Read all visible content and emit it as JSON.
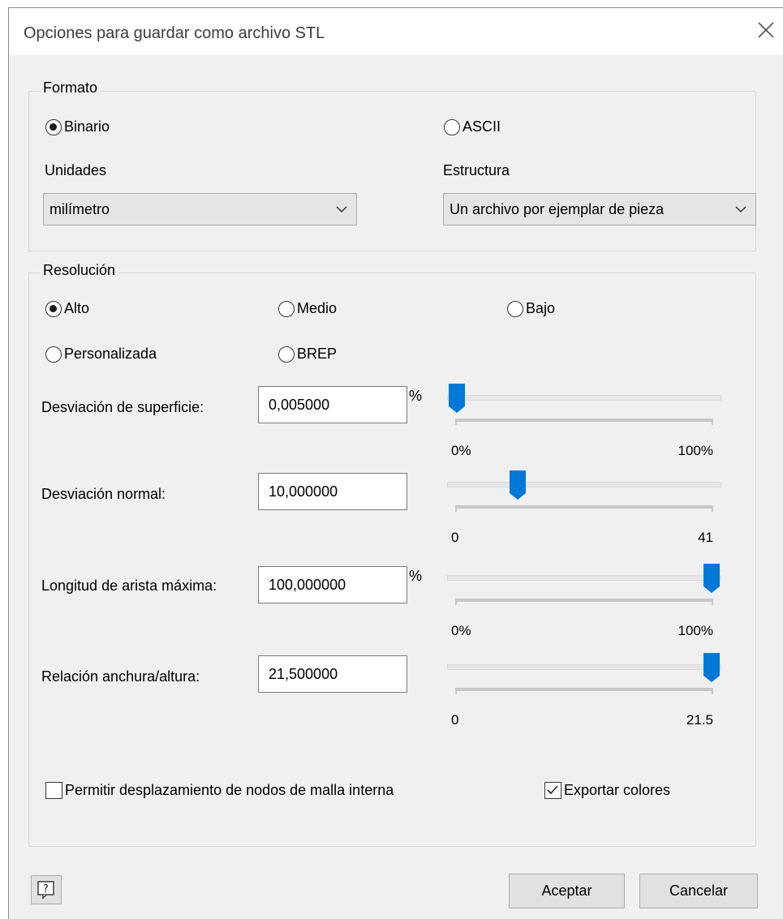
{
  "window": {
    "title": "Opciones para guardar como archivo STL"
  },
  "formato": {
    "legend": "Formato",
    "binario_label": "Binario",
    "ascii_label": "ASCII",
    "selected": "Binario",
    "unidades_label": "Unidades",
    "unidades_value": "milímetro",
    "estructura_label": "Estructura",
    "estructura_value": "Un archivo por ejemplar de pieza"
  },
  "resolucion": {
    "legend": "Resolución",
    "alto_label": "Alto",
    "medio_label": "Medio",
    "bajo_label": "Bajo",
    "personalizada_label": "Personalizada",
    "brep_label": "BREP",
    "selected": "Alto",
    "params": [
      {
        "label": "Desviación de superficie:",
        "value": "0,005000",
        "unit": "%",
        "min_label": "0%",
        "max_label": "100%",
        "slider_fraction": 0.0
      },
      {
        "label": "Desviación normal:",
        "value": "10,000000",
        "unit": "",
        "min_label": "0",
        "max_label": "41",
        "slider_fraction": 0.24
      },
      {
        "label": "Longitud de arista máxima:",
        "value": "100,000000",
        "unit": "%",
        "min_label": "0%",
        "max_label": "100%",
        "slider_fraction": 1.0
      },
      {
        "label": "Relación anchura/altura:",
        "value": "21,500000",
        "unit": "",
        "min_label": "0",
        "max_label": "21.5",
        "slider_fraction": 1.0
      }
    ],
    "permitir_label": "Permitir desplazamiento de nodos de malla interna",
    "permitir_checked": false,
    "exportar_label": "Exportar colores",
    "exportar_checked": true
  },
  "buttons": {
    "aceptar": "Aceptar",
    "cancelar": "Cancelar"
  },
  "colors": {
    "accent": "#0078d7",
    "dialog_bg": "#f0f0f0"
  }
}
